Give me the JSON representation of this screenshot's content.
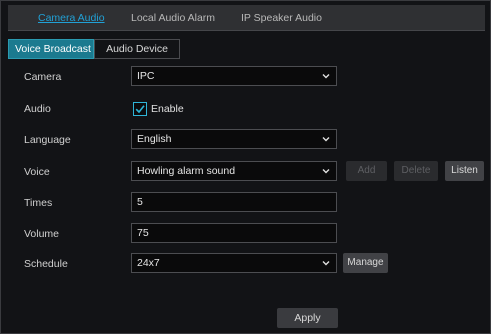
{
  "top_tabs": [
    {
      "label": "Camera Audio",
      "active": true
    },
    {
      "label": "Local Audio Alarm",
      "active": false
    },
    {
      "label": "IP Speaker Audio",
      "active": false
    }
  ],
  "sub_tabs": [
    {
      "label": "Voice Broadcast",
      "active": true
    },
    {
      "label": "Audio Device",
      "active": false
    }
  ],
  "form": {
    "camera": {
      "label": "Camera",
      "value": "IPC"
    },
    "audio": {
      "label": "Audio",
      "checkbox_label": "Enable",
      "checked": true
    },
    "language": {
      "label": "Language",
      "value": "English"
    },
    "voice": {
      "label": "Voice",
      "value": "Howling alarm sound"
    },
    "times": {
      "label": "Times",
      "value": "5"
    },
    "volume": {
      "label": "Volume",
      "value": "75"
    },
    "schedule": {
      "label": "Schedule",
      "value": "24x7"
    }
  },
  "buttons": {
    "add": "Add",
    "delete": "Delete",
    "listen": "Listen",
    "manage": "Manage",
    "apply": "Apply"
  },
  "colors": {
    "accent": "#21a1d6",
    "active_subtab": "#1b7a8f",
    "background": "#121316"
  }
}
